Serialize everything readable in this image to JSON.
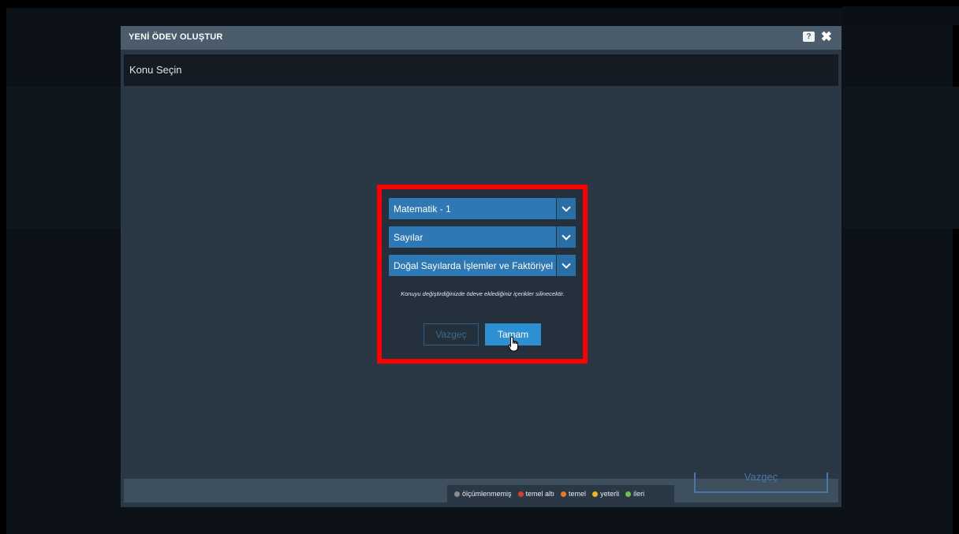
{
  "modal": {
    "title": "YENİ ÖDEV OLUŞTUR",
    "help_icon": "?",
    "close_icon": "✖",
    "section_title": "Konu Seçin"
  },
  "selector": {
    "course": "Matematik - 1",
    "unit": "Sayılar",
    "topic": "Doğal Sayılarda İşlemler ve Faktöriyel",
    "note": "Konuyu değiştirdiğinizde ödeve eklediğiniz içerikler silinecektir.",
    "cancel_label": "Vazgeç",
    "ok_label": "Tamam"
  },
  "footer": {
    "legend": [
      {
        "label": "ölçümlenmemiş",
        "color": "#8c8c8c"
      },
      {
        "label": "temel altı",
        "color": "#e03a2c"
      },
      {
        "label": "temel",
        "color": "#e97a24"
      },
      {
        "label": "yeterli",
        "color": "#f2b21c"
      },
      {
        "label": "ileri",
        "color": "#6cc24a"
      }
    ],
    "cancel_label": "Vazgeç"
  },
  "colors": {
    "highlight": "#ff0000",
    "accent": "#2e8fd3",
    "select_bg": "#2e79b5"
  }
}
